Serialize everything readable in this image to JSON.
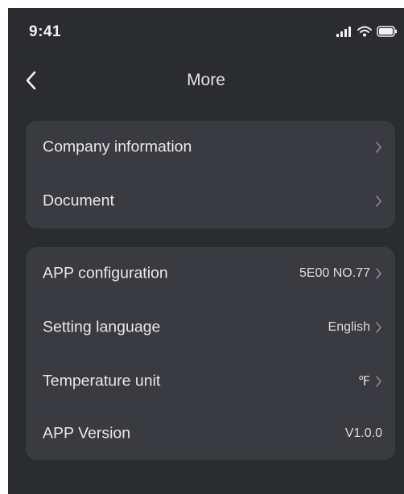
{
  "status_bar": {
    "time": "9:41"
  },
  "header": {
    "title": "More"
  },
  "group1": {
    "items": [
      {
        "label": "Company information"
      },
      {
        "label": "Document"
      }
    ]
  },
  "group2": {
    "items": [
      {
        "label": "APP configuration",
        "value": "5E00 NO.77"
      },
      {
        "label": "Setting language",
        "value": "English"
      },
      {
        "label": "Temperature unit",
        "value": "℉"
      },
      {
        "label": "APP Version",
        "value": "V1.0.0"
      }
    ]
  },
  "icons": [
    "back-icon",
    "signal-icon",
    "wifi-icon",
    "battery-icon",
    "chevron-right-icon"
  ],
  "colors": {
    "background": "#2b2c30",
    "card": "#3a3b40",
    "text": "#e8e8ec",
    "chevron": "#8a8a90"
  }
}
